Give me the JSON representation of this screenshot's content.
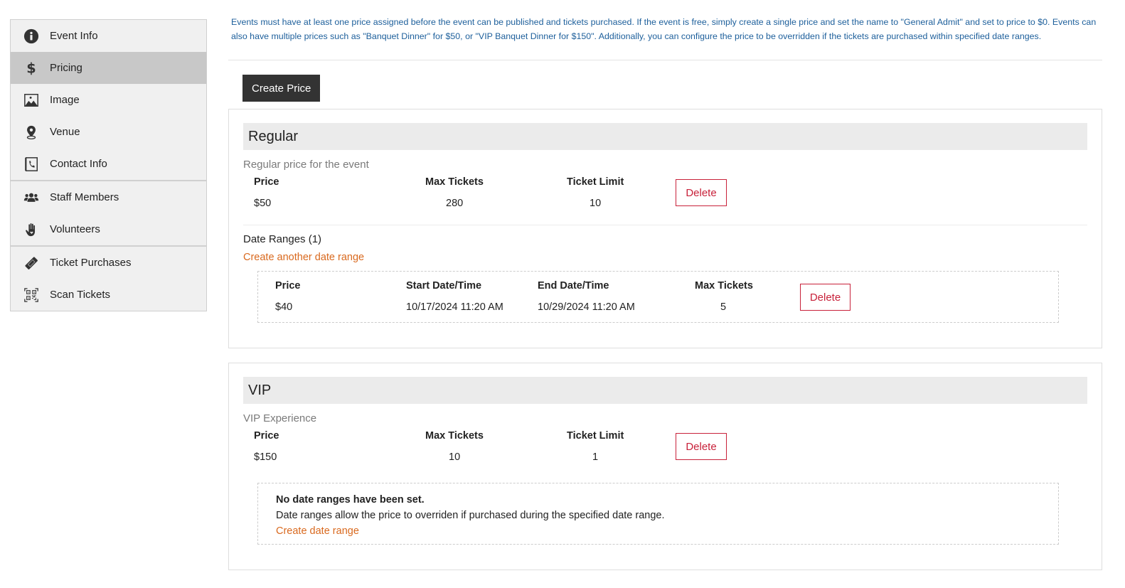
{
  "sidebar": {
    "items": [
      {
        "label": "Event Info",
        "icon": "info-circle-icon",
        "active": false
      },
      {
        "label": "Pricing",
        "icon": "dollar-icon",
        "active": true
      },
      {
        "label": "Image",
        "icon": "image-icon",
        "active": false
      },
      {
        "label": "Venue",
        "icon": "map-pin-icon",
        "active": false
      },
      {
        "label": "Contact Info",
        "icon": "contact-book-icon",
        "active": false
      },
      {
        "label": "Staff Members",
        "icon": "users-icon",
        "active": false
      },
      {
        "label": "Volunteers",
        "icon": "hand-heart-icon",
        "active": false
      },
      {
        "label": "Ticket Purchases",
        "icon": "ticket-icon",
        "active": false
      },
      {
        "label": "Scan Tickets",
        "icon": "qr-code-icon",
        "active": false
      }
    ]
  },
  "main": {
    "intro_text": "Events must have at least one price assigned before the event can be published and tickets purchased. If the event is free, simply create a single price and set the name to \"General Admit\" and set to price to $0. Events can also have multiple prices such as \"Banquet Dinner\" for $50, or \"VIP Banquet Dinner for $150\". Additionally, you can configure the price to be overridden if the tickets are purchased within specified date ranges.",
    "create_price_label": "Create Price",
    "colors": {
      "accent_link": "#d9691e",
      "delete": "#c8213a",
      "intro": "#1d5f9b"
    },
    "prices": [
      {
        "name": "Regular",
        "description": "Regular price for the event",
        "headers": {
          "price": "Price",
          "max_tickets": "Max Tickets",
          "ticket_limit": "Ticket Limit"
        },
        "price": "$50",
        "max_tickets": "280",
        "ticket_limit": "10",
        "delete_label": "Delete",
        "date_ranges_title": "Date Ranges (1)",
        "create_another_label": "Create another date range",
        "date_range_headers": {
          "price": "Price",
          "start": "Start Date/Time",
          "end": "End Date/Time",
          "max_tickets": "Max Tickets"
        },
        "date_ranges": [
          {
            "price": "$40",
            "start": "10/17/2024 11:20 AM",
            "end": "10/29/2024 11:20 AM",
            "max_tickets": "5",
            "delete_label": "Delete"
          }
        ]
      },
      {
        "name": "VIP",
        "description": "VIP Experience",
        "headers": {
          "price": "Price",
          "max_tickets": "Max Tickets",
          "ticket_limit": "Ticket Limit"
        },
        "price": "$150",
        "max_tickets": "10",
        "ticket_limit": "1",
        "delete_label": "Delete",
        "empty": {
          "title": "No date ranges have been set.",
          "text": "Date ranges allow the price to overriden if purchased during the specified date range.",
          "create_label": "Create date range"
        }
      }
    ]
  }
}
